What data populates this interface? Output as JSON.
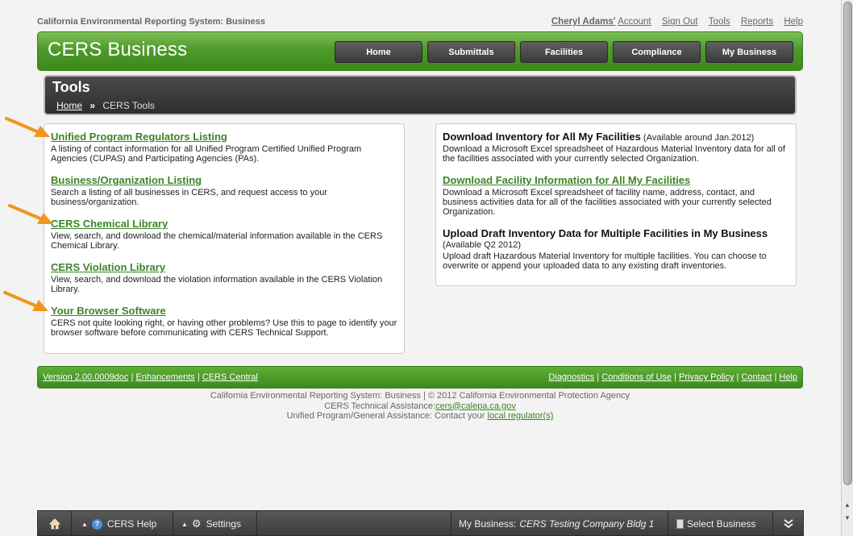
{
  "top": {
    "system_title": "California Environmental Reporting System: Business",
    "user_name": "Cheryl Adams'",
    "account": "Account",
    "links": [
      "Sign Out",
      "Tools",
      "Reports",
      "Help"
    ]
  },
  "header": {
    "brand": "CERS Business",
    "nav": [
      "Home",
      "Submittals",
      "Facilities",
      "Compliance",
      "My Business"
    ]
  },
  "page": {
    "title": "Tools",
    "breadcrumb_home": "Home",
    "breadcrumb_sep": "»",
    "breadcrumb_current": "CERS Tools"
  },
  "left_tools": [
    {
      "title": "Unified Program Regulators Listing",
      "desc": "A listing of contact information for all Unified Program Certified Unified Program Agencies (CUPAS) and Participating Agencies (PAs)."
    },
    {
      "title": "Business/Organization Listing",
      "desc": "Search a listing of all businesses in CERS, and request access to your business/organization."
    },
    {
      "title": "CERS Chemical Library",
      "desc": "View, search, and download the chemical/material information available in the CERS Chemical Library."
    },
    {
      "title": "CERS Violation Library",
      "desc": "View, search, and download the violation information available in the CERS Violation Library."
    },
    {
      "title": "Your Browser Software",
      "desc": "CERS not quite looking right, or having other problems? Use this to page to identify your browser software before communicating with CERS Technical Support."
    }
  ],
  "right_tools": [
    {
      "title": "Download Inventory for All My Facilities",
      "avail": "(Available around Jan.2012)",
      "desc": "Download a Microsoft Excel spreadsheet of Hazardous Material Inventory data for all of the facilities associated with your currently selected Organization."
    },
    {
      "title": "Download Facility Information for All My Facilities",
      "desc": "Download a Microsoft Excel spreadsheet of facility name, address, contact, and business activities data for all of the facilities associated with your currently selected Organization."
    },
    {
      "title": "Upload Draft Inventory Data for Multiple Facilities in My Business",
      "avail": "(Available Q2 2012)",
      "desc": "Upload draft Hazardous Material Inventory for multiple facilities. You can choose to overwrite or append your uploaded data to any existing draft inventories."
    }
  ],
  "footer": {
    "left_links": [
      "Version 2.00.0009doc",
      "Enhancements",
      "CERS Central"
    ],
    "right_links": [
      "Diagnostics",
      "Conditions of Use",
      "Privacy Policy",
      "Contact",
      "Help"
    ],
    "separator": "|",
    "line1": "California Environmental Reporting System: Business | © 2012 California Environmental Protection Agency",
    "line2_prefix": "CERS Technical Assistance:",
    "line2_email": "cers@calepa.ca.gov",
    "line3_prefix": "Unified Program/General Assistance: Contact your ",
    "line3_link": "local regulator(s)"
  },
  "toolbar": {
    "help": "CERS Help",
    "settings": "Settings",
    "business_label": "My Business:",
    "business_name": "CERS Testing Company Bldg 1",
    "select_business": "Select Business"
  },
  "colors": {
    "accent_green": "#4e9a2a",
    "link_green": "#3b8526",
    "arrow_orange": "#f0961e"
  }
}
